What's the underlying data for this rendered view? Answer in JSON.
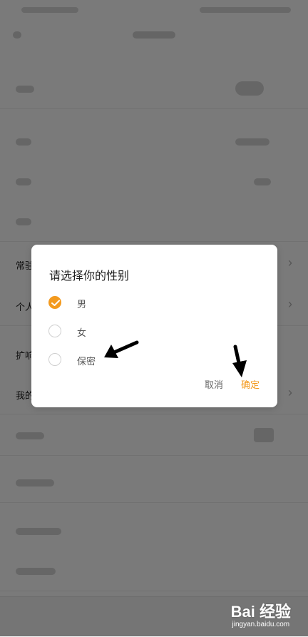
{
  "background": {
    "rows": [
      {
        "label": ""
      },
      {
        "label": ""
      },
      {
        "label": ""
      },
      {
        "label": ""
      },
      {
        "label": "常驻"
      },
      {
        "label": "个人"
      },
      {
        "label": "扩响"
      },
      {
        "label": "我的"
      },
      {
        "label": ""
      },
      {
        "label": ""
      },
      {
        "label": ""
      },
      {
        "label": ""
      }
    ]
  },
  "dialog": {
    "title": "请选择你的性别",
    "options": [
      {
        "label": "男",
        "selected": true
      },
      {
        "label": "女",
        "selected": false
      },
      {
        "label": "保密",
        "selected": false
      }
    ],
    "cancel_label": "取消",
    "confirm_label": "确定"
  },
  "watermark": {
    "brand": "Bai 经验",
    "url": "jingyan.baidu.com"
  },
  "colors": {
    "accent": "#f39a1e",
    "overlay": "rgba(0,0,0,0.52)"
  }
}
